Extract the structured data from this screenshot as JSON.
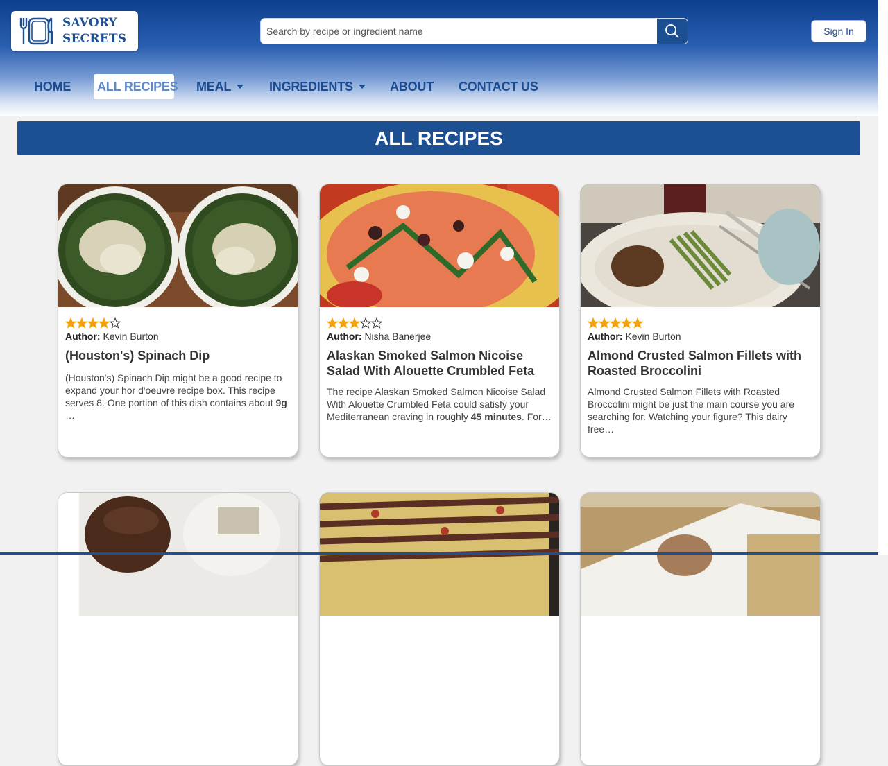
{
  "brand": {
    "line1": "SAVORY",
    "line2": "SECRETS",
    "logo_icon": "plate-fork-knife-icon",
    "color": "#1d4f93"
  },
  "search": {
    "placeholder": "Search by recipe or ingredient name",
    "value": ""
  },
  "auth": {
    "sign_in": "Sign In"
  },
  "nav": {
    "home": "HOME",
    "all_recipes": "ALL RECIPES",
    "meal": "MEAL",
    "ingredients": "INGREDIENTS",
    "about": "ABOUT",
    "contact": "CONTACT US",
    "active": "all_recipes"
  },
  "page_title": "ALL RECIPES",
  "recipes": [
    {
      "rating": 4,
      "author_label": "Author:",
      "author": "Kevin Burton",
      "title": "(Houston's) Spinach Dip",
      "desc_pre": "(Houston's) Spinach Dip might be a good recipe to expand your hor d'oeuvre recipe box. This recipe serves 8. One portion of this dish contains about ",
      "desc_bold": "9g",
      "desc_post": " …",
      "image": "spinach-dip-photo"
    },
    {
      "rating": 3,
      "author_label": "Author:",
      "author": "Nisha Banerjee",
      "title": "Alaskan Smoked Salmon Nicoise Salad With Alouette Crumbled Feta",
      "desc_pre": "The recipe Alaskan Smoked Salmon Nicoise Salad With Alouette Crumbled Feta could satisfy your Mediterranean craving in roughly ",
      "desc_bold": "45 minutes",
      "desc_post": ". For…",
      "image": "salmon-salad-photo"
    },
    {
      "rating": 5,
      "author_label": "Author:",
      "author": "Kevin Burton",
      "title": "Almond Crusted Salmon Fillets with Roasted Broccolini",
      "desc_pre": "Almond Crusted Salmon Fillets with Roasted Broccolini might be just the main course you are searching for. Watching your figure? This dairy free…",
      "desc_bold": "",
      "desc_post": "",
      "image": "salmon-broccolini-photo"
    }
  ],
  "colors": {
    "primary": "#1d4f93",
    "star": "#f2a20c",
    "nav_active": "#5d8ac9"
  }
}
